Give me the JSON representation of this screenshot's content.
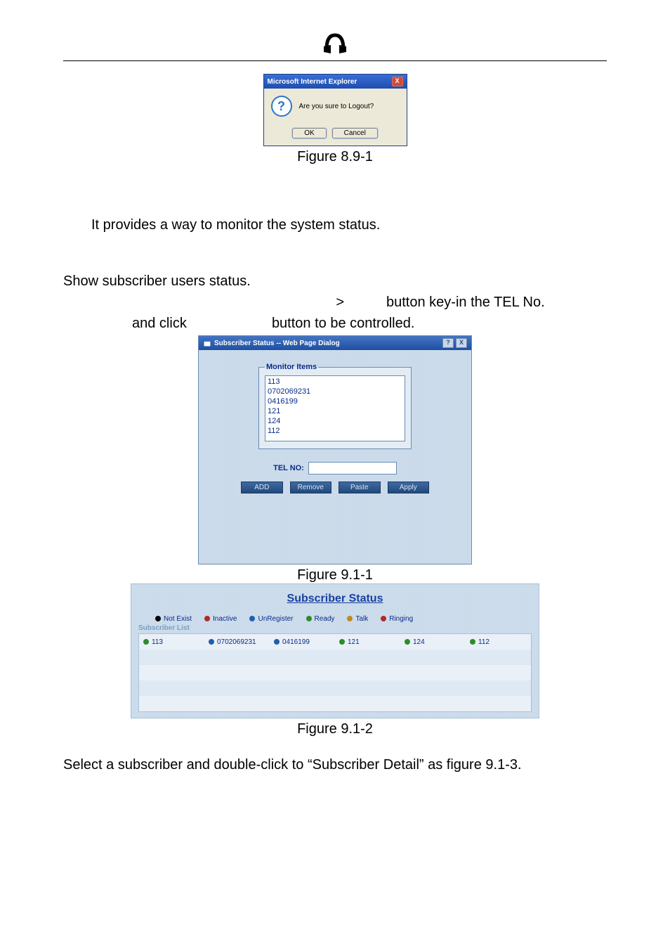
{
  "header_icon_alt": "logo",
  "ie_dialog": {
    "title": "Microsoft Internet Explorer",
    "message": "Are you sure to Logout?",
    "ok": "OK",
    "cancel": "Cancel",
    "close": "X"
  },
  "fig_8_9_1": "Figure 8.9-1",
  "paragraph_monitor": "It provides a way to monitor the system status.",
  "paragraph_show": "Show subscriber users status.",
  "line_gt": ">",
  "line_btn_keyin": "button key-in the TEL No.",
  "line_clickprefix": "and click",
  "line_clicksuffix": "button to be controlled.",
  "sub_dialog": {
    "title": "Subscriber Status -- Web Page Dialog",
    "help": "?",
    "close": "X",
    "legend": "Monitor Items",
    "items": [
      "113",
      "0702069231",
      "0416199",
      "121",
      "124",
      "112"
    ],
    "telno_label": "TEL NO:",
    "telno_value": "",
    "btn_add": "ADD",
    "btn_remove": "Remove",
    "btn_paste": "Paste",
    "btn_apply": "Apply"
  },
  "fig_9_1_1": "Figure 9.1-1",
  "sub_panel": {
    "title": "Subscriber Status",
    "legend": [
      {
        "label": "Not Exist",
        "color": "#000000"
      },
      {
        "label": "Inactive",
        "color": "#b02a2a"
      },
      {
        "label": "UnRegister",
        "color": "#1e5fb0"
      },
      {
        "label": "Ready",
        "color": "#2e8b2e"
      },
      {
        "label": "Talk",
        "color": "#c08a1e"
      },
      {
        "label": "Ringing",
        "color": "#b02a2a"
      }
    ],
    "list_label": "Subscriber List",
    "row": [
      {
        "v": "113",
        "c": "#2e8b2e"
      },
      {
        "v": "0702069231",
        "c": "#1e5fb0"
      },
      {
        "v": "0416199",
        "c": "#1e5fb0"
      },
      {
        "v": "121",
        "c": "#2e8b2e"
      },
      {
        "v": "124",
        "c": "#2e8b2e"
      },
      {
        "v": "112",
        "c": "#2e8b2e"
      }
    ]
  },
  "fig_9_1_2": "Figure 9.1-2",
  "paragraph_detail": "Select a subscriber and double-click to “Subscriber Detail” as figure 9.1-3."
}
